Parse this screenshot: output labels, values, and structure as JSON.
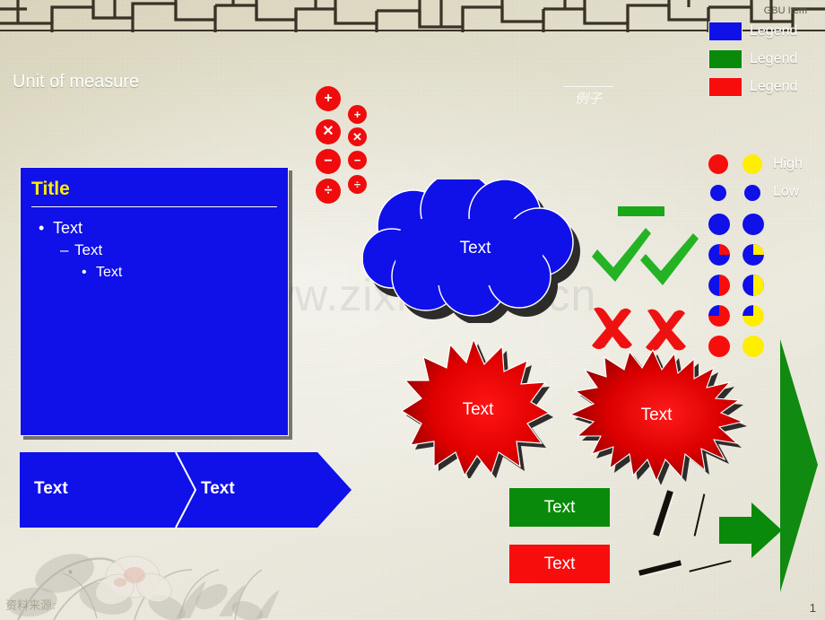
{
  "slide": {
    "unit_of_measure": "Unit of measure",
    "example_label": "例子",
    "watermark": "www.zixin.com.cn",
    "source_label": "资料来源:",
    "footnote_marker": "*",
    "page_number": "1"
  },
  "legend": {
    "header": "GBU Item",
    "items": [
      {
        "label": "Legend",
        "color": "#1010e8"
      },
      {
        "label": "Legend",
        "color": "#0a8a0a"
      },
      {
        "label": "Legend",
        "color": "#f80d0d"
      }
    ]
  },
  "title_box": {
    "title": "Title",
    "bullets": [
      {
        "level": 1,
        "marker": "•",
        "text": "Text"
      },
      {
        "level": 2,
        "marker": "–",
        "text": "Text"
      },
      {
        "level": 3,
        "marker": "•",
        "text": "Text"
      }
    ],
    "fill_color": "#1010e8",
    "title_color": "#ffee00"
  },
  "chevron_banner": {
    "segments": [
      {
        "text": "Text"
      },
      {
        "text": "Text"
      }
    ],
    "fill_color": "#1010e8"
  },
  "operators": {
    "large": [
      "+",
      "✕",
      "−",
      "÷"
    ],
    "small": [
      "+",
      "✕",
      "−",
      "÷"
    ],
    "color": "#f00c0c"
  },
  "cloud": {
    "text": "Text",
    "fill_color": "#1010e8"
  },
  "starbursts": [
    {
      "text": "Text",
      "fill_color": "#d40000",
      "points": 16
    },
    {
      "text": "Text",
      "fill_color": "#d40000",
      "points": 26
    }
  ],
  "marks": {
    "dash_color": "#1aa81a",
    "check_color": "#24b324",
    "cross_color": "#ef1111",
    "checks": 2,
    "crosses": 2,
    "dashes": 1
  },
  "harvey_balls": {
    "labels": {
      "high": "High",
      "low": "Low"
    },
    "left_accent": "#f80d0d",
    "right_accent": "#ffee00",
    "base_color": "#1010e8",
    "rows": [
      {
        "size": 22,
        "fill_percent": 0,
        "note": "full-accent"
      },
      {
        "size": 18,
        "fill_percent": 100,
        "note": "full-base-small"
      },
      {
        "size": 24,
        "fill_percent": 100,
        "note": "full-base-large"
      },
      {
        "size": 24,
        "fill_percent": 75,
        "note": "three-quarter-base"
      },
      {
        "size": 24,
        "fill_percent": 50,
        "note": "half-base"
      },
      {
        "size": 24,
        "fill_percent": 25,
        "note": "quarter-base"
      },
      {
        "size": 24,
        "fill_percent": 0,
        "note": "full-accent"
      }
    ]
  },
  "bottom_boxes": [
    {
      "text": "Text",
      "fill_color": "#0a8a0a"
    },
    {
      "text": "Text",
      "fill_color": "#f80d0d"
    }
  ],
  "green_shapes": {
    "arrow_color": "#0a8a0a",
    "triangle_color": "#108a10"
  },
  "strokes": {
    "count": 4,
    "color": "#15100c"
  }
}
